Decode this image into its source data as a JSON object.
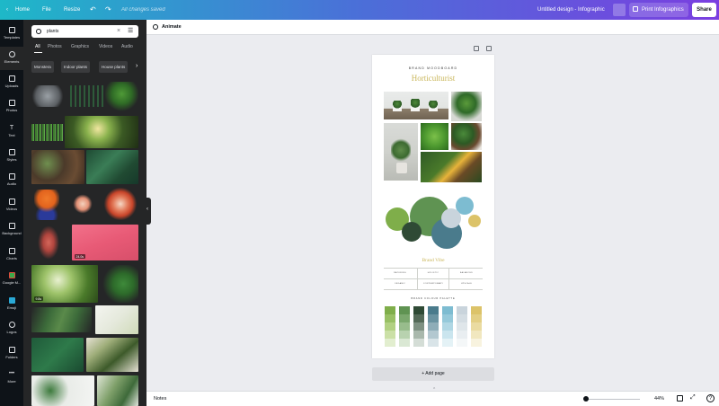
{
  "topbar": {
    "home": "Home",
    "file": "File",
    "resize": "Resize",
    "saved_status": "All changes saved",
    "doc_title": "Untitled design - Infographic",
    "print_label": "Print Infographics",
    "share_label": "Share"
  },
  "rail": [
    {
      "label": "Templates",
      "icon": "templates-icon"
    },
    {
      "label": "Elements",
      "icon": "elements-icon"
    },
    {
      "label": "Uploads",
      "icon": "upload-icon"
    },
    {
      "label": "Photos",
      "icon": "photos-icon"
    },
    {
      "label": "Text",
      "icon": "text-icon"
    },
    {
      "label": "Styles",
      "icon": "styles-icon"
    },
    {
      "label": "Audio",
      "icon": "audio-icon"
    },
    {
      "label": "Videos",
      "icon": "videos-icon"
    },
    {
      "label": "Background",
      "icon": "background-icon"
    },
    {
      "label": "Charts",
      "icon": "charts-icon"
    },
    {
      "label": "Google M...",
      "icon": "google-maps-icon"
    },
    {
      "label": "Emoji",
      "icon": "emoji-icon"
    },
    {
      "label": "Logos",
      "icon": "logos-icon"
    },
    {
      "label": "Folders",
      "icon": "folders-icon"
    },
    {
      "label": "More",
      "icon": "more-icon"
    }
  ],
  "search": {
    "value": "plants"
  },
  "tabs": [
    "All",
    "Photos",
    "Graphics",
    "Videos",
    "Audio"
  ],
  "chips": [
    "Monstera",
    "Indoor plants",
    "House plants"
  ],
  "thumbs": {
    "video_duration_1": "24.0s",
    "video_duration_2": "9.8s"
  },
  "toolbar": {
    "animate": "Animate"
  },
  "design": {
    "brand_label": "BRAND MOODBOARD",
    "title": "Horticulturist",
    "vibe_title": "Brand Vibe",
    "vibe_words": [
      "NATURING",
      "HOLISTIC",
      "BALANCED",
      "ORGANIC",
      "CONTEMPORARY",
      "UPSCALE"
    ],
    "palette_title": "BRAND COLOUR PALETTE",
    "palette_colors": [
      "#7fae4a",
      "#5f9352",
      "#2f4a35",
      "#4a7b8c",
      "#7dbcd1",
      "#c9d4dc",
      "#dcc369"
    ]
  },
  "addpage": "+ Add page",
  "bottom": {
    "notes": "Notes",
    "zoom": "44%"
  }
}
